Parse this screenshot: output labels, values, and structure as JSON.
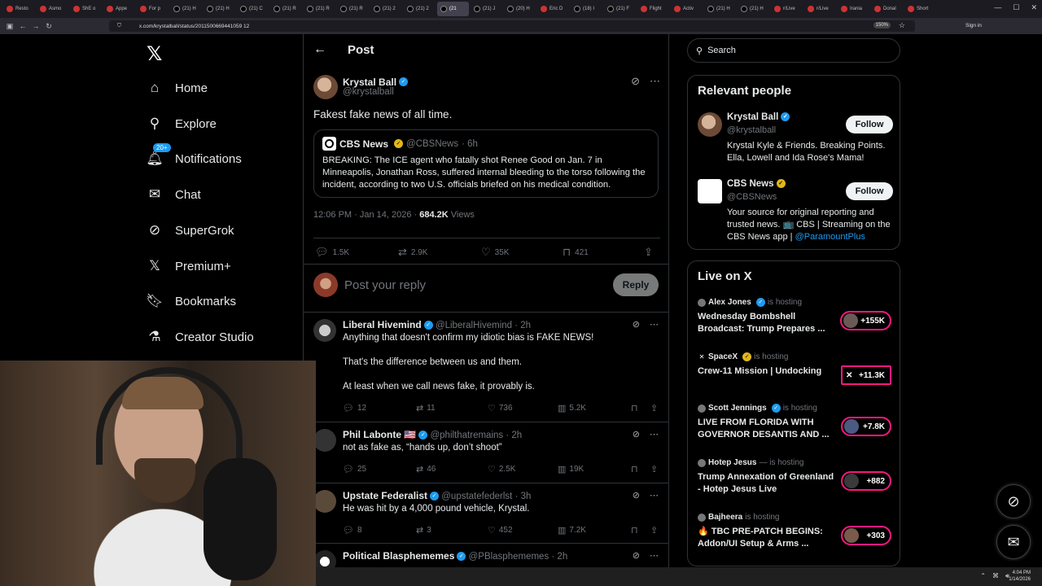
{
  "browser": {
    "tabs": [
      "Resto",
      "Asmo",
      "ShE o",
      "Appe",
      "For p",
      "(21) H",
      "(21) H",
      "(21) C",
      "(21) R",
      "(21) R",
      "(21) R",
      "(21) 2",
      "(21) 2",
      "(21",
      "(21) J",
      "(20) H",
      "Eric D",
      "(18) I",
      "(21) F",
      "Flight",
      "Activ",
      "(21) H",
      "(21) H",
      "r/Live",
      "r/Live",
      "Irania",
      "Donal",
      "Short"
    ],
    "active_tab_index": 13,
    "url": "x.com/krystalball/status/2011500669441059 12",
    "zoom": "150%",
    "signin": "Sign in"
  },
  "left_nav": {
    "items": [
      {
        "label": "Home",
        "icon": "home-icon"
      },
      {
        "label": "Explore",
        "icon": "search-icon"
      },
      {
        "label": "Notifications",
        "icon": "bell-icon",
        "badge": "20+"
      },
      {
        "label": "Chat",
        "icon": "mail-icon"
      },
      {
        "label": "SuperGrok",
        "icon": "grok-icon"
      },
      {
        "label": "Premium+",
        "icon": "x-icon"
      },
      {
        "label": "Bookmarks",
        "icon": "bookmark-icon"
      },
      {
        "label": "Creator Studio",
        "icon": "flask-icon"
      }
    ]
  },
  "post_header": {
    "title": "Post"
  },
  "main_tweet": {
    "name": "Krystal Ball",
    "handle": "@krystalball",
    "text": "Fakest fake news of all time.",
    "quote": {
      "name": "CBS News",
      "handle": "@CBSNews",
      "age": "· 6h",
      "text": "BREAKING: The ICE agent who fatally shot Renee Good on Jan. 7 in Minneapolis, Jonathan Ross, suffered internal bleeding to the torso following the incident, according to two U.S. officials briefed on his medical condition."
    },
    "time": "12:06 PM · Jan 14, 2026 · ",
    "views": "684.2K",
    "views_label": " Views",
    "stats": {
      "replies": "1.5K",
      "reposts": "2.9K",
      "likes": "35K",
      "bookmarks": "421"
    }
  },
  "reply_box": {
    "placeholder": "Post your reply",
    "button": "Reply"
  },
  "replies": [
    {
      "name": "Liberal Hivemind",
      "handle": "@LiberalHivemind",
      "age": "· 2h",
      "lines": [
        "Anything that doesn't confirm my idiotic bias is FAKE NEWS!",
        "",
        "That's the difference between us and them.",
        "",
        "At least when we call news fake, it provably is."
      ],
      "replies": "12",
      "reposts": "11",
      "likes": "736",
      "views": "5.2K"
    },
    {
      "name": "Phil Labonte 🇺🇸",
      "handle": "@philthatremains",
      "age": "· 2h",
      "lines": [
        "not as fake as, “hands up, don’t shoot”"
      ],
      "replies": "25",
      "reposts": "46",
      "likes": "2.5K",
      "views": "19K"
    },
    {
      "name": "Upstate Federalist",
      "handle": "@upstatefederlst",
      "age": "· 3h",
      "lines": [
        "He was hit by a 4,000 pound vehicle, Krystal."
      ],
      "replies": "8",
      "reposts": "3",
      "likes": "452",
      "views": "7.2K"
    },
    {
      "name": "Political Blasphememes",
      "handle": "@PBlasphememes",
      "age": "· 2h",
      "lines": [],
      "replies": "",
      "reposts": "",
      "likes": "",
      "views": ""
    }
  ],
  "search": {
    "placeholder": "Search"
  },
  "relevant_people": {
    "title": "Relevant people",
    "people": [
      {
        "name": "Krystal Ball",
        "handle": "@krystalball",
        "bio": "Krystal Kyle & Friends. Breaking Points. Ella, Lowell and Ida Rose's Mama!",
        "bio_link": "",
        "follow": "Follow"
      },
      {
        "name": "CBS News",
        "handle": "@CBSNews",
        "bio": "Your source for original reporting and trusted news. 📺 CBS | Streaming on the CBS News app | ",
        "bio_link": "@ParamountPlus",
        "follow": "Follow"
      }
    ]
  },
  "live": {
    "title": "Live on X",
    "items": [
      {
        "host": "Alex Jones",
        "suffix": "is hosting",
        "title": "Wednesday Bombshell Broadcast: Trump Prepares ...",
        "count": "+155K"
      },
      {
        "host": "SpaceX",
        "suffix": "is hosting",
        "title": "Crew-11 Mission | Undocking",
        "count": "+11.3K"
      },
      {
        "host": "Scott Jennings",
        "suffix": "is hosting",
        "title": "LIVE FROM FLORIDA WITH GOVERNOR DESANTIS AND ...",
        "count": "+7.8K"
      },
      {
        "host": "Hotep Jesus",
        "suffix": "— is hosting",
        "title": "Trump Annexation of Greenland - Hotep Jesus Live",
        "count": "+882"
      },
      {
        "host": "Bajheera",
        "suffix": "is hosting",
        "title": "🔥 TBC PRE-PATCH BEGINS: Addon/UI Setup & Arms ...",
        "count": "+303"
      }
    ]
  },
  "taskbar": {
    "time": "4:04 PM",
    "date": "1/14/2026"
  },
  "colors": {
    "accent": "#1d9bf0",
    "live": "#f91880",
    "gold": "#e2b719"
  }
}
